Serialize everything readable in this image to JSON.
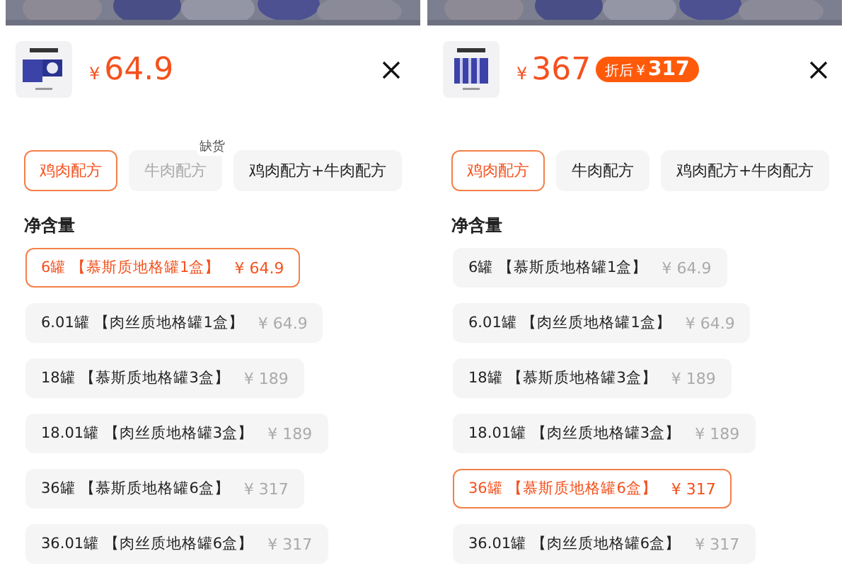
{
  "panels": [
    {
      "price_symbol": "¥",
      "price": "64.9",
      "flavors": [
        {
          "label": "鸡肉配方",
          "selected": true,
          "disabled": false
        },
        {
          "label": "牛肉配方",
          "selected": false,
          "disabled": true,
          "tag": "缺货"
        },
        {
          "label": "鸡肉配方+牛肉配方",
          "selected": false,
          "disabled": false
        }
      ],
      "section_title": "净含量",
      "sizes": [
        {
          "name": "6罐 【慕斯质地格罐1盒】",
          "price": "¥ 64.9",
          "selected": true
        },
        {
          "name": "6.01罐 【肉丝质地格罐1盒】",
          "price": "¥ 64.9",
          "selected": false
        },
        {
          "name": "18罐 【慕斯质地格罐3盒】",
          "price": "¥ 189",
          "selected": false
        },
        {
          "name": "18.01罐 【肉丝质地格罐3盒】",
          "price": "¥ 189",
          "selected": false
        },
        {
          "name": "36罐 【慕斯质地格罐6盒】",
          "price": "¥ 317",
          "selected": false
        },
        {
          "name": "36.01罐 【肉丝质地格罐6盒】",
          "price": "¥ 317",
          "selected": false
        }
      ]
    },
    {
      "price_symbol": "¥",
      "price": "367",
      "discount": {
        "label": "折后",
        "symbol": "¥",
        "price": "317"
      },
      "flavors": [
        {
          "label": "鸡肉配方",
          "selected": true,
          "disabled": false
        },
        {
          "label": "牛肉配方",
          "selected": false,
          "disabled": false
        },
        {
          "label": "鸡肉配方+牛肉配方",
          "selected": false,
          "disabled": false
        }
      ],
      "section_title": "净含量",
      "sizes": [
        {
          "name": "6罐 【慕斯质地格罐1盒】",
          "price": "¥ 64.9",
          "selected": false
        },
        {
          "name": "6.01罐 【肉丝质地格罐1盒】",
          "price": "¥ 64.9",
          "selected": false
        },
        {
          "name": "18罐 【慕斯质地格罐3盒】",
          "price": "¥ 189",
          "selected": false
        },
        {
          "name": "18.01罐 【肉丝质地格罐3盒】",
          "price": "¥ 189",
          "selected": false
        },
        {
          "name": "36罐 【慕斯质地格罐6盒】",
          "price": "¥ 317",
          "selected": true
        },
        {
          "name": "36.01罐 【肉丝质地格罐6盒】",
          "price": "¥ 317",
          "selected": false
        }
      ]
    }
  ]
}
